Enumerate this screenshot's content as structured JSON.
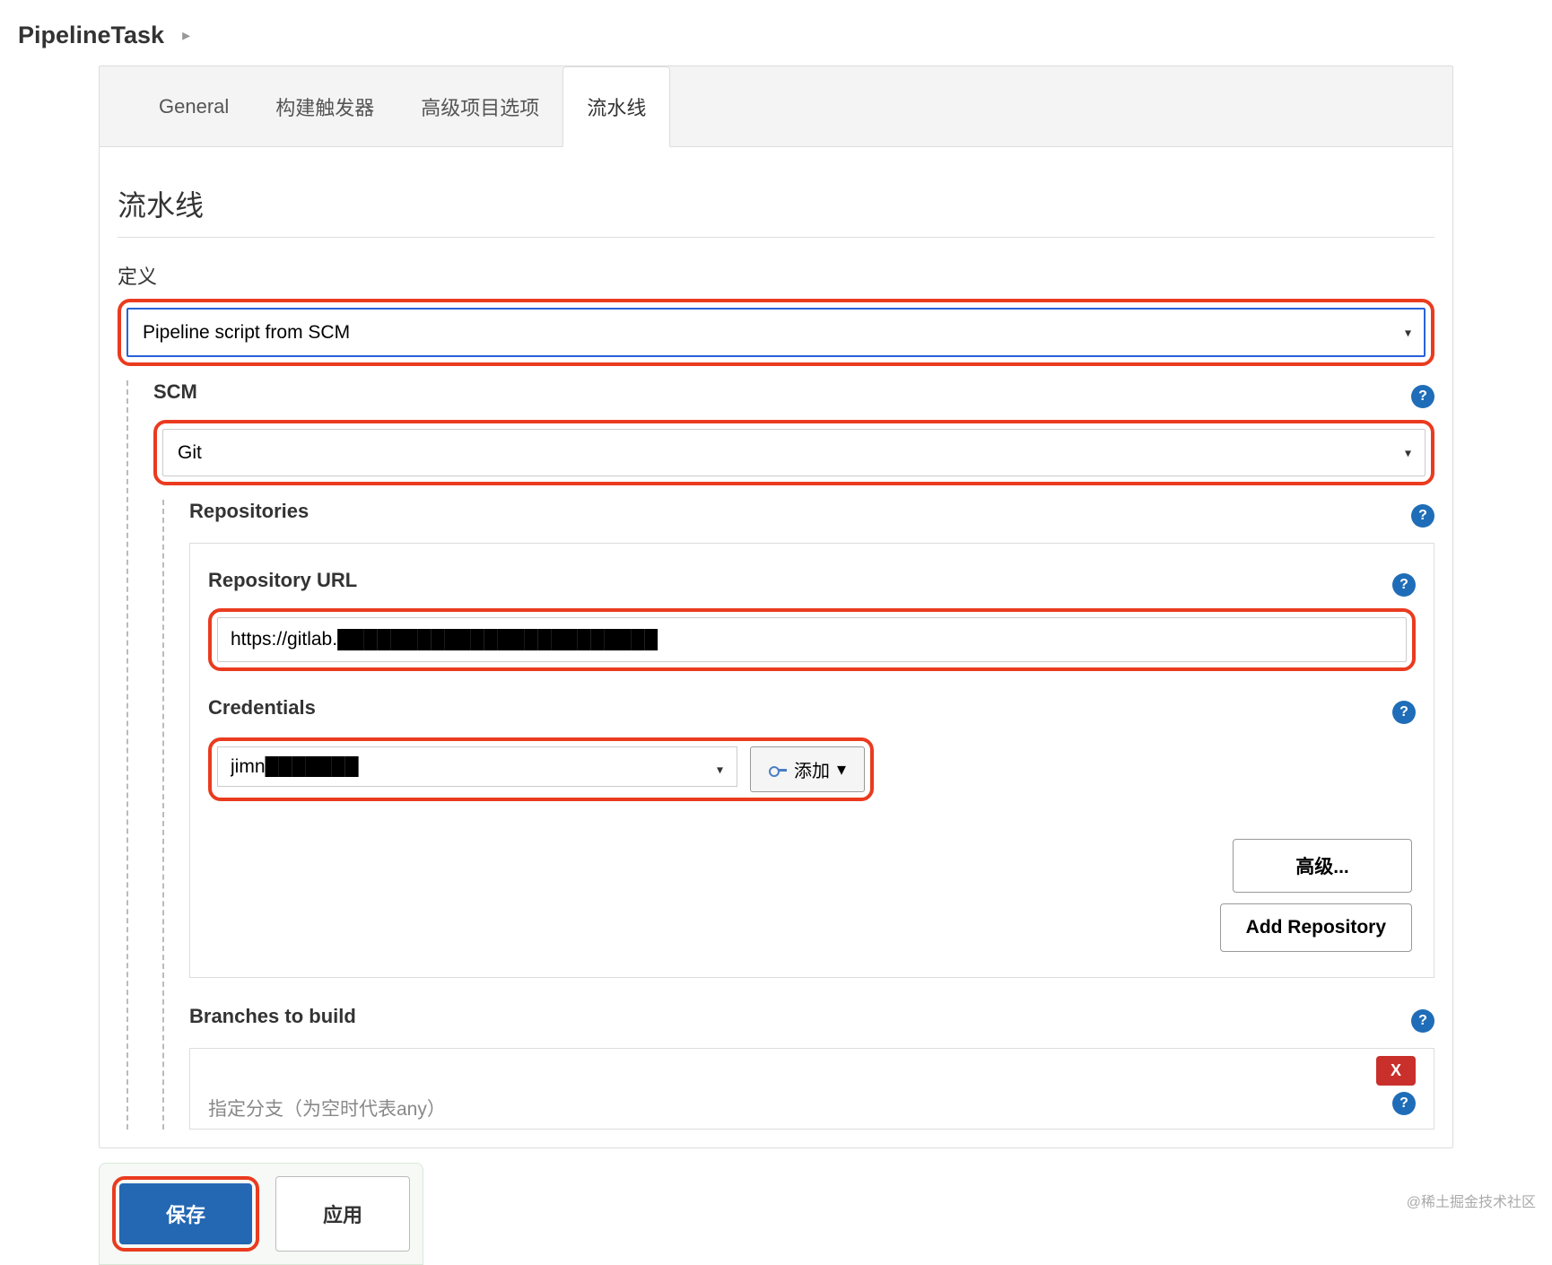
{
  "header": {
    "title": "PipelineTask"
  },
  "tabs": [
    {
      "label": "General"
    },
    {
      "label": "构建触发器"
    },
    {
      "label": "高级项目选项"
    },
    {
      "label": "流水线",
      "active": true
    }
  ],
  "section": {
    "title": "流水线"
  },
  "definition": {
    "label": "定义",
    "value": "Pipeline script from SCM"
  },
  "scm": {
    "label": "SCM",
    "value": "Git"
  },
  "repositories": {
    "label": "Repositories",
    "url_label": "Repository URL",
    "url_value": "https://gitlab.████████████████████████",
    "credentials_label": "Credentials",
    "credentials_value": "jimn███████",
    "add_label": "添加",
    "advanced_label": "高级...",
    "add_repo_label": "Add Repository"
  },
  "branches": {
    "label": "Branches to build",
    "spec_label": "指定分支（为空时代表any）",
    "delete_label": "X"
  },
  "buttons": {
    "save": "保存",
    "apply": "应用"
  },
  "watermark": "@稀土掘金技术社区"
}
